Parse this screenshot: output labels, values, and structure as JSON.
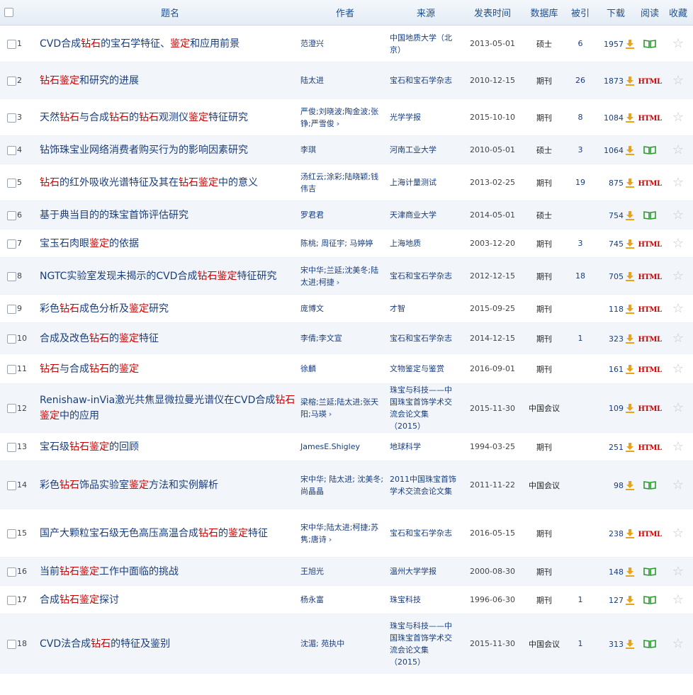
{
  "header": {
    "title": "题名",
    "author": "作者",
    "source": "来源",
    "date": "发表时间",
    "database": "数据库",
    "cited": "被引",
    "download": "下载",
    "read": "阅读",
    "favorite": "收藏"
  },
  "colors": {
    "highlight": "#cc0000",
    "link": "#1a3d7c",
    "html": "#cc0000",
    "book": "#2e9a2e",
    "download": "#e8a21c"
  },
  "rows": [
    {
      "idx": "1",
      "title": [
        [
          "CVD合成",
          false
        ],
        [
          "钻石",
          true
        ],
        [
          "的宝石学特征、",
          false
        ],
        [
          "鉴定",
          true
        ],
        [
          "和应用前景",
          false
        ]
      ],
      "author": "范澄兴",
      "author_more": false,
      "source": "中国地质大学（北京）",
      "date": "2013-05-01",
      "db": "硕士",
      "cited": "6",
      "downloads": "1957",
      "read": "book"
    },
    {
      "idx": "2",
      "title": [
        [
          "钻石鉴定",
          true
        ],
        [
          "和研究的进展",
          false
        ]
      ],
      "author": "陆太进",
      "author_more": false,
      "source": "宝石和宝石学杂志",
      "date": "2010-12-15",
      "db": "期刊",
      "cited": "26",
      "downloads": "1873",
      "read": "html"
    },
    {
      "idx": "3",
      "title": [
        [
          "天然",
          false
        ],
        [
          "钻石",
          true
        ],
        [
          "与合成",
          false
        ],
        [
          "钻石",
          true
        ],
        [
          "的",
          false
        ],
        [
          "钻石",
          true
        ],
        [
          "观测仪",
          false
        ],
        [
          "鉴定",
          true
        ],
        [
          "特征研究",
          false
        ]
      ],
      "author": "严俊;刘晓波;陶金波;张铮;严雪俊",
      "author_more": true,
      "source": "光学学报",
      "date": "2015-10-10",
      "db": "期刊",
      "cited": "8",
      "downloads": "1084",
      "read": "html"
    },
    {
      "idx": "4",
      "title": [
        [
          "钻饰珠宝业网络消费者购买行为的影响因素研究",
          false
        ]
      ],
      "author": "李琪",
      "author_more": false,
      "source": "河南工业大学",
      "date": "2010-05-01",
      "db": "硕士",
      "cited": "3",
      "downloads": "1064",
      "read": "book"
    },
    {
      "idx": "5",
      "title": [
        [
          "钻石",
          true
        ],
        [
          "的红外吸收光谱特征及其在",
          false
        ],
        [
          "钻石鉴定",
          true
        ],
        [
          "中的意义",
          false
        ]
      ],
      "author": "汤红云;涂彩;陆晓颖;钱伟吉",
      "author_more": false,
      "source": "上海计量测试",
      "date": "2013-02-25",
      "db": "期刊",
      "cited": "19",
      "downloads": "875",
      "read": "html"
    },
    {
      "idx": "6",
      "title": [
        [
          "基于典当目的的珠宝首饰评估研究",
          false
        ]
      ],
      "author": "罗君君",
      "author_more": false,
      "source": "天津商业大学",
      "date": "2014-05-01",
      "db": "硕士",
      "cited": "",
      "downloads": "754",
      "read": "book"
    },
    {
      "idx": "7",
      "title": [
        [
          "宝玉石肉眼",
          false
        ],
        [
          "鉴定",
          true
        ],
        [
          "的依据",
          false
        ]
      ],
      "author": "陈桃; 周征宇; 马婷婷",
      "author_more": false,
      "source": "上海地质",
      "date": "2003-12-20",
      "db": "期刊",
      "cited": "3",
      "downloads": "745",
      "read": "html"
    },
    {
      "idx": "8",
      "title": [
        [
          "NGTC实验室发现未揭示的CVD合成",
          false
        ],
        [
          "钻石鉴定",
          true
        ],
        [
          "特征研究",
          false
        ]
      ],
      "author": "宋中华;兰延;沈美冬;陆太进;柯捷",
      "author_more": true,
      "source": "宝石和宝石学杂志",
      "date": "2012-12-15",
      "db": "期刊",
      "cited": "18",
      "downloads": "705",
      "read": "html"
    },
    {
      "idx": "9",
      "title": [
        [
          "彩色",
          false
        ],
        [
          "钻石",
          true
        ],
        [
          "成色分析及",
          false
        ],
        [
          "鉴定",
          true
        ],
        [
          "研究",
          false
        ]
      ],
      "author": "庞博文",
      "author_more": false,
      "source": "才智",
      "date": "2015-09-25",
      "db": "期刊",
      "cited": "",
      "downloads": "118",
      "read": "html"
    },
    {
      "idx": "10",
      "title": [
        [
          "合成及改色",
          false
        ],
        [
          "钻石",
          true
        ],
        [
          "的",
          false
        ],
        [
          "鉴定",
          true
        ],
        [
          "特征",
          false
        ]
      ],
      "author": "李倩;李文宣",
      "author_more": false,
      "source": "宝石和宝石学杂志",
      "date": "2014-12-15",
      "db": "期刊",
      "cited": "1",
      "downloads": "323",
      "read": "html"
    },
    {
      "idx": "11",
      "title": [
        [
          "钻石",
          true
        ],
        [
          "与合成",
          false
        ],
        [
          "钻石",
          true
        ],
        [
          "的",
          false
        ],
        [
          "鉴定",
          true
        ]
      ],
      "author": "徐麟",
      "author_more": false,
      "source": "文物鉴定与鉴赏",
      "date": "2016-09-01",
      "db": "期刊",
      "cited": "",
      "downloads": "161",
      "read": "html"
    },
    {
      "idx": "12",
      "title": [
        [
          "Renishaw-inVia激光共焦显微拉曼光谱仪在CVD合成",
          false
        ],
        [
          "钻石鉴定",
          true
        ],
        [
          "中的应用",
          false
        ]
      ],
      "author": "梁榕;兰延;陆太进;张天阳;马瑛",
      "author_more": true,
      "source": "珠宝与科技——中国珠宝首饰学术交流会论文集（2015）",
      "date": "2015-11-30",
      "db": "中国会议",
      "cited": "",
      "downloads": "109",
      "read": "html"
    },
    {
      "idx": "13",
      "title": [
        [
          "宝石级",
          false
        ],
        [
          "钻石鉴定",
          true
        ],
        [
          "的回顾",
          false
        ]
      ],
      "author": "JamesE.Shigley",
      "author_more": false,
      "source": "地球科学",
      "date": "1994-03-25",
      "db": "期刊",
      "cited": "",
      "downloads": "251",
      "read": "html"
    },
    {
      "idx": "14",
      "title": [
        [
          "彩色",
          false
        ],
        [
          "钻石",
          true
        ],
        [
          "饰品实验室",
          false
        ],
        [
          "鉴定",
          true
        ],
        [
          "方法和实例解析",
          false
        ]
      ],
      "author": "宋中华; 陆太进; 沈美冬; 尚晶晶",
      "author_more": false,
      "source": "2011中国珠宝首饰学术交流会论文集",
      "date": "2011-11-22",
      "db": "中国会议",
      "cited": "",
      "downloads": "98",
      "read": "book"
    },
    {
      "idx": "15",
      "title": [
        [
          "国产大颗粒宝石级无色高压高温合成",
          false
        ],
        [
          "钻石",
          true
        ],
        [
          "的",
          false
        ],
        [
          "鉴定",
          true
        ],
        [
          "特征",
          false
        ]
      ],
      "author": "宋中华;陆太进;柯捷;苏隽;唐诗",
      "author_more": true,
      "source": "宝石和宝石学杂志",
      "date": "2016-05-15",
      "db": "期刊",
      "cited": "",
      "downloads": "238",
      "read": "html"
    },
    {
      "idx": "16",
      "title": [
        [
          "当前",
          false
        ],
        [
          "钻石鉴定",
          true
        ],
        [
          "工作中面临的挑战",
          false
        ]
      ],
      "author": "王旭光",
      "author_more": false,
      "source": "温州大学学报",
      "date": "2000-08-30",
      "db": "期刊",
      "cited": "",
      "downloads": "148",
      "read": "book"
    },
    {
      "idx": "17",
      "title": [
        [
          "合成",
          false
        ],
        [
          "钻石鉴定",
          true
        ],
        [
          "探讨",
          false
        ]
      ],
      "author": "杨永富",
      "author_more": false,
      "source": "珠宝科技",
      "date": "1996-06-30",
      "db": "期刊",
      "cited": "1",
      "downloads": "127",
      "read": "book"
    },
    {
      "idx": "18",
      "title": [
        [
          "CVD法合成",
          false
        ],
        [
          "钻石",
          true
        ],
        [
          "的特征及鉴别",
          false
        ]
      ],
      "author": "沈湄; 苑执中",
      "author_more": false,
      "source": "珠宝与科技——中国珠宝首饰学术交流会论文集（2015）",
      "date": "2015-11-30",
      "db": "中国会议",
      "cited": "1",
      "downloads": "313",
      "read": "book"
    }
  ],
  "labels": {
    "html": "HTML",
    "more": "›"
  }
}
